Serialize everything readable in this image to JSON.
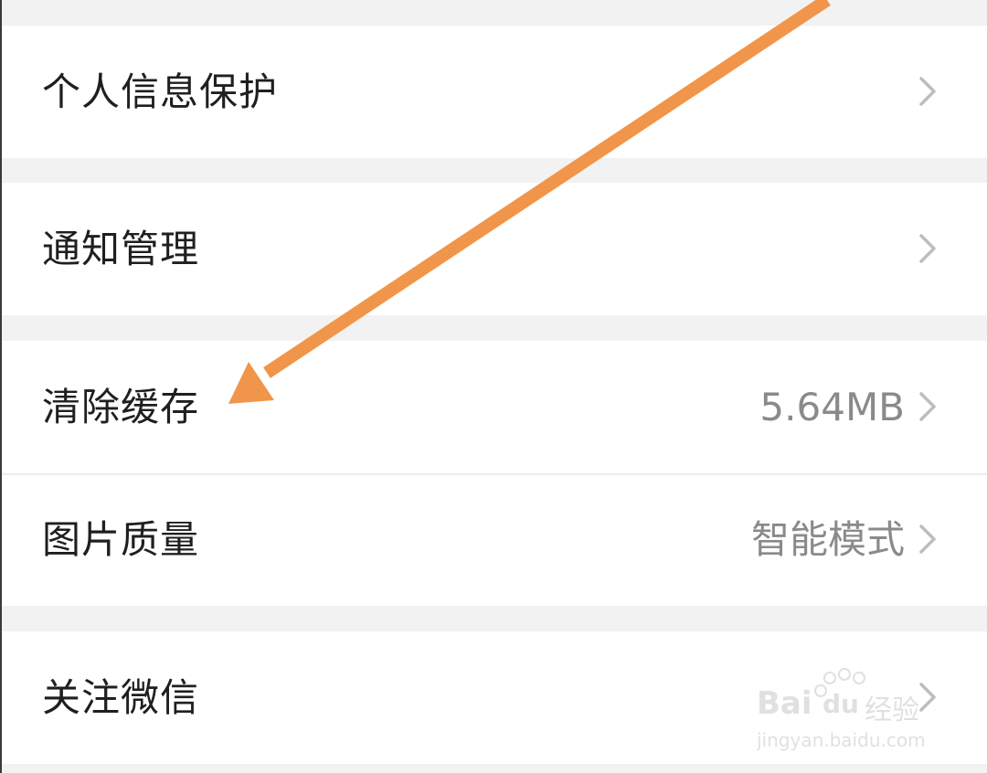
{
  "settings": {
    "items": [
      {
        "label": "个人信息保护",
        "value": ""
      },
      {
        "label": "通知管理",
        "value": ""
      },
      {
        "label": "清除缓存",
        "value": "5.64MB"
      },
      {
        "label": "图片质量",
        "value": "智能模式"
      },
      {
        "label": "关注微信",
        "value": ""
      }
    ]
  },
  "colors": {
    "background": "#f2f2f2",
    "row": "#ffffff",
    "label": "#1f1f1f",
    "value": "#8a8a8a",
    "chevron": "#bdbdbd",
    "annotation_arrow": "#f0954a"
  },
  "watermark": {
    "brand": "Bai",
    "brand_suffix": "du",
    "product": "经验",
    "url": "jingyan.baidu.com"
  }
}
